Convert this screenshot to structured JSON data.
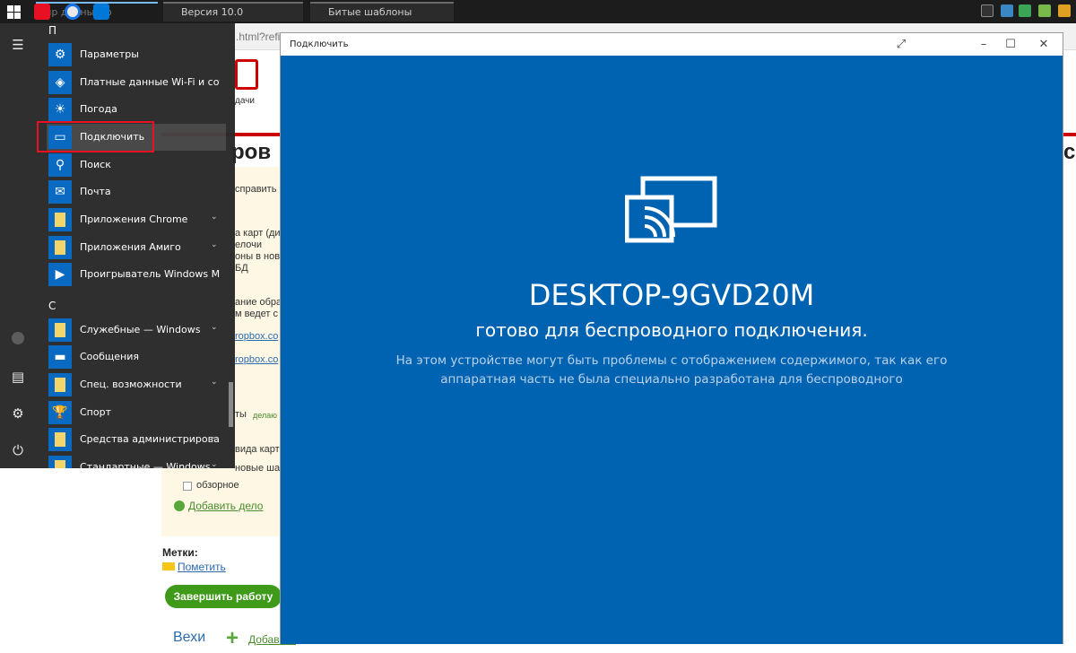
{
  "taskbar": {
    "tabs": [
      {
        "label": "Т ир  данных ф"
      },
      {
        "label": "Версия 10.0"
      },
      {
        "label": "Битые шаблоны"
      }
    ]
  },
  "background_page": {
    "url_fragment": ".html?refi",
    "tasks_link": "дачи",
    "heading": "ров",
    "heading_right": "ст",
    "lines": [
      "справить н",
      "а карт (ди",
      "елочи",
      "оны в нов",
      "БД",
      "ание обра",
      "м ведет с",
      "ropbox.co",
      "ropbox.co",
      "ты",
      "делаю",
      "вида карт",
      "новые шаблоны в"
    ],
    "review_label": "обзорное",
    "add_task_label": "Добавить дело",
    "tags_label": "Метки:",
    "mark_label": "Пометить",
    "finish_button": "Завершить работу",
    "milestones_label": "Вехи",
    "add_label": "Добавить"
  },
  "start_menu": {
    "group_p": "П",
    "group_s": "С",
    "items": [
      {
        "label": "Параметры",
        "icon": "gear-icon",
        "glyph": "⚙",
        "expandable": false
      },
      {
        "label": "Платные данные Wi-Fi и сотовой...",
        "icon": "wifi-tag-icon",
        "glyph": "◈",
        "expandable": false
      },
      {
        "label": "Погода",
        "icon": "sun-icon",
        "glyph": "☀",
        "expandable": false
      },
      {
        "label": "Подключить",
        "icon": "cast-icon",
        "glyph": "▭",
        "expandable": false
      },
      {
        "label": "Поиск",
        "icon": "search-icon",
        "glyph": "⚲",
        "expandable": false
      },
      {
        "label": "Почта",
        "icon": "mail-icon",
        "glyph": "✉",
        "expandable": false
      },
      {
        "label": "Приложения Chrome",
        "icon": "folder-icon",
        "glyph": "",
        "expandable": true
      },
      {
        "label": "Приложения Амиго",
        "icon": "folder-icon",
        "glyph": "",
        "expandable": true
      },
      {
        "label": "Проигрыватель Windows Media",
        "icon": "play-icon",
        "glyph": "▶",
        "expandable": false
      },
      {
        "label": "Служебные — Windows",
        "icon": "folder-icon",
        "glyph": "",
        "expandable": true
      },
      {
        "label": "Сообщения",
        "icon": "message-icon",
        "glyph": "▬",
        "expandable": false
      },
      {
        "label": "Спец. возможности",
        "icon": "folder-icon",
        "glyph": "",
        "expandable": true
      },
      {
        "label": "Спорт",
        "icon": "trophy-icon",
        "glyph": "🏆",
        "expandable": false
      },
      {
        "label": "Средства администрировани...",
        "icon": "folder-icon",
        "glyph": "",
        "expandable": true
      },
      {
        "label": "Стандартные — Windows",
        "icon": "folder-icon",
        "glyph": "",
        "expandable": true
      }
    ],
    "chevron_glyph": "⌄"
  },
  "connect_window": {
    "title": "Подключить",
    "device_name": "DESKTOP-9GVD20M",
    "ready_text": "готово для беспроводного подключения.",
    "warning_text": "На этом устройстве могут быть проблемы с отображением содержимого, так как его аппаратная часть не была специально разработана для беспроводного"
  },
  "colors": {
    "connect_background": "#0063b1",
    "highlight_border": "#e81123",
    "tile_blue": "#0a6ac2",
    "finish_button": "#3e9a18"
  }
}
